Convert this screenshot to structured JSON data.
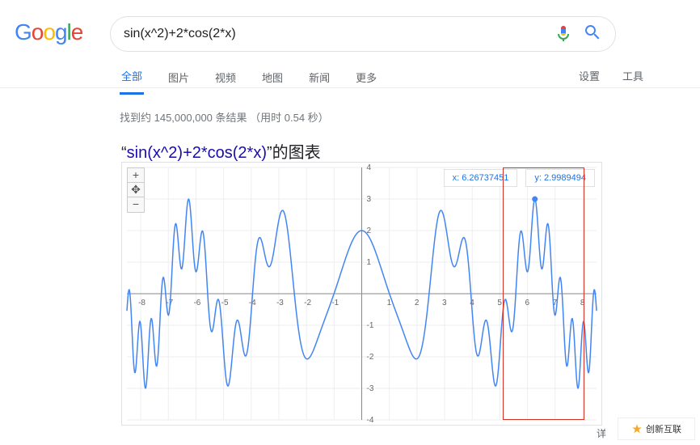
{
  "logo": {
    "text": "Google"
  },
  "search": {
    "query": "sin(x^2)+2*cos(2*x)"
  },
  "tabs": {
    "items": [
      "全部",
      "图片",
      "视频",
      "地图",
      "新闻",
      "更多"
    ],
    "active_index": 0,
    "right": [
      "设置",
      "工具"
    ]
  },
  "stats": {
    "text": "找到约 145,000,000 条结果  （用时 0.54 秒）"
  },
  "chart_title": {
    "link_text": "sin(x^2)+2*cos(2*x)",
    "prefix": "“",
    "suffix": "”的图表"
  },
  "tooltip": {
    "x_label": "x: 6.26737451",
    "y_label": "y: 2.9989494"
  },
  "detail": {
    "text": "详"
  },
  "footer": {
    "brand": "创新互联"
  },
  "chart_data": {
    "type": "line",
    "title": "sin(x^2)+2*cos(2*x)",
    "xlabel": "",
    "ylabel": "",
    "xlim": [
      -8.5,
      8.5
    ],
    "ylim": [
      -4,
      4
    ],
    "xticks": [
      -8,
      -7,
      -6,
      -5,
      -4,
      -3,
      -2,
      -1,
      1,
      2,
      3,
      4,
      5,
      6,
      7,
      8
    ],
    "yticks": [
      -4,
      -3,
      -2,
      -1,
      1,
      2,
      3,
      4
    ],
    "series": [
      {
        "name": "sin(x^2)+2*cos(2*x)",
        "formula": "sin(x*x)+2*cos(2*x)",
        "x_range": [
          -8.5,
          8.5
        ],
        "samples": 1200,
        "color": "#4285f4"
      }
    ],
    "highlight_point": {
      "x": 6.26737451,
      "y": 2.9989494
    },
    "highlight_rect": {
      "x0": 5.1,
      "x1": 8.05,
      "y0": -4,
      "y1": 4
    }
  }
}
